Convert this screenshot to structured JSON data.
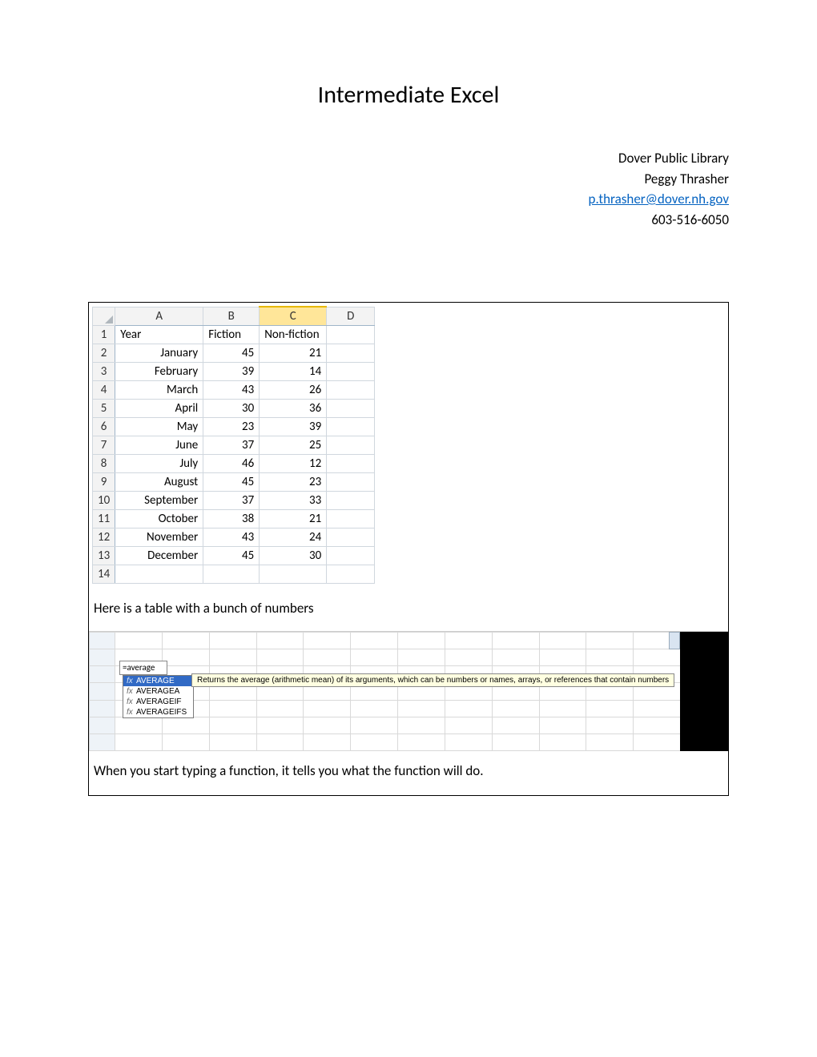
{
  "title": "Intermediate Excel",
  "header": {
    "org": "Dover Public Library",
    "author": "Peggy Thrasher",
    "email": "p.thrasher@dover.nh.gov",
    "phone": "603-516-6050"
  },
  "excel": {
    "columns": [
      "A",
      "B",
      "C",
      "D"
    ],
    "selected_column_index": 2,
    "headers_row": {
      "A": "Year",
      "B": "Fiction",
      "C": "Non-fiction",
      "D": ""
    },
    "rows": [
      {
        "n": 2,
        "A": "January",
        "B": 45,
        "C": 21
      },
      {
        "n": 3,
        "A": "February",
        "B": 39,
        "C": 14
      },
      {
        "n": 4,
        "A": "March",
        "B": 43,
        "C": 26
      },
      {
        "n": 5,
        "A": "April",
        "B": 30,
        "C": 36
      },
      {
        "n": 6,
        "A": "May",
        "B": 23,
        "C": 39
      },
      {
        "n": 7,
        "A": "June",
        "B": 37,
        "C": 25
      },
      {
        "n": 8,
        "A": "July",
        "B": 46,
        "C": 12
      },
      {
        "n": 9,
        "A": "August",
        "B": 45,
        "C": 23
      },
      {
        "n": 10,
        "A": "September",
        "B": 37,
        "C": 33
      },
      {
        "n": 11,
        "A": "October",
        "B": 38,
        "C": 21
      },
      {
        "n": 12,
        "A": "November",
        "B": 43,
        "C": 24
      },
      {
        "n": 13,
        "A": "December",
        "B": 45,
        "C": 30
      }
    ],
    "empty_row": 14
  },
  "caption1": "Here is a table with a bunch of numbers",
  "formula": {
    "typed": "=average",
    "suggestions": [
      "AVERAGE",
      "AVERAGEA",
      "AVERAGEIF",
      "AVERAGEIFS"
    ],
    "selected_index": 0,
    "tooltip": "Returns the average (arithmetic mean) of its arguments, which can be numbers or names, arrays, or references that contain numbers"
  },
  "caption2": "When you start typing a function, it tells you what the function will do."
}
